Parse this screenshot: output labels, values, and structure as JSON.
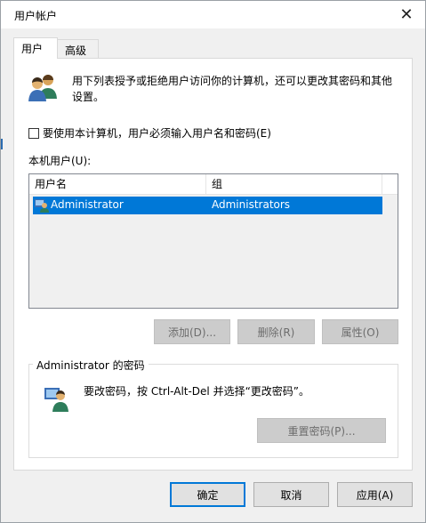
{
  "window": {
    "title": "用户帐户",
    "close_glyph": "✕"
  },
  "tabs": [
    {
      "label": "用户",
      "active": true
    },
    {
      "label": "高级",
      "active": false
    }
  ],
  "users_tab": {
    "description": "用下列表授予或拒绝用户访问你的计算机，还可以更改其密码和其他设置。",
    "require_login_checkbox": {
      "label": "要使用本计算机，用户必须输入用户名和密码(E)",
      "checked": false
    },
    "local_users_label": "本机用户(U):",
    "list": {
      "columns": [
        "用户名",
        "组"
      ],
      "rows": [
        {
          "user": "Administrator",
          "group": "Administrators",
          "selected": true
        }
      ]
    },
    "buttons": {
      "add": "添加(D)...",
      "remove": "删除(R)",
      "properties": "属性(O)"
    },
    "password_group": {
      "title": "Administrator 的密码",
      "description": "要改密码，按 Ctrl-Alt-Del 并选择“更改密码”。",
      "reset_button": "重置密码(P)..."
    }
  },
  "footer": {
    "ok": "确定",
    "cancel": "取消",
    "apply": "应用(A)"
  },
  "colors": {
    "selection": "#0078d7",
    "dialog_bg": "#f0f0f0",
    "panel_bg": "#ffffff"
  },
  "icons": {
    "users": "users-icon",
    "user": "user-icon"
  }
}
